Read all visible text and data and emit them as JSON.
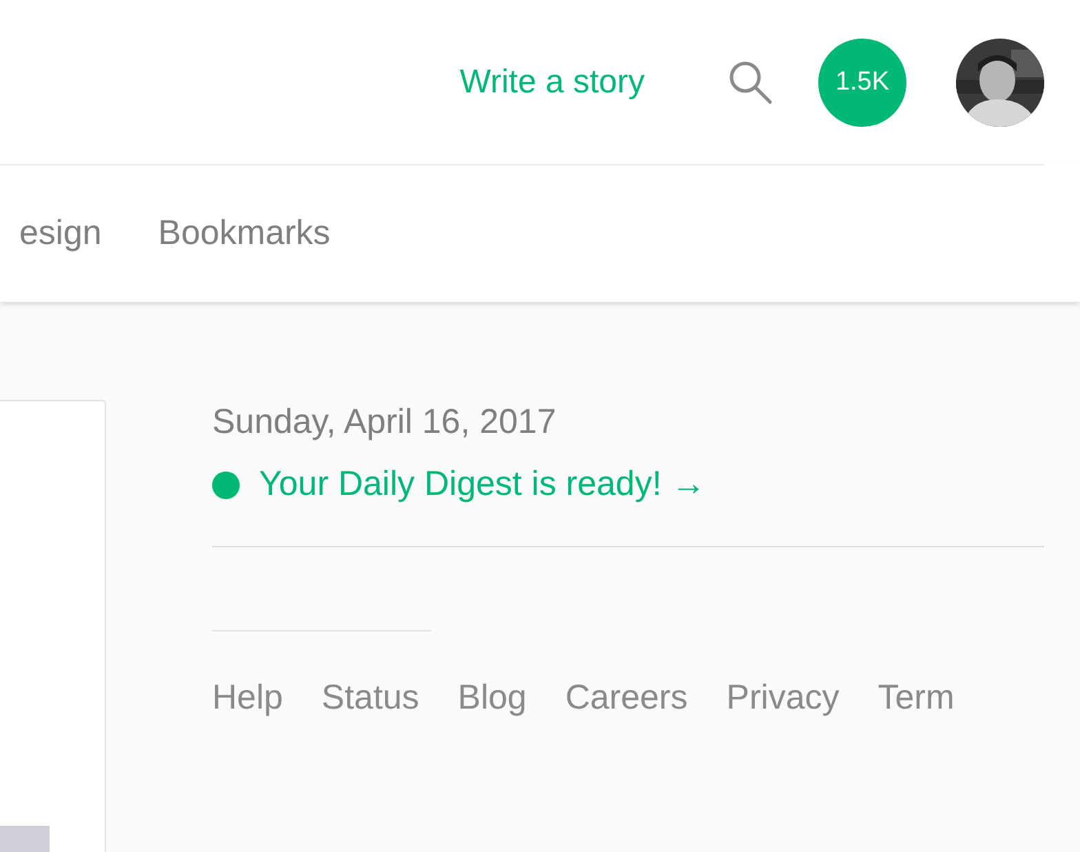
{
  "header": {
    "write_link": "Write a story",
    "notification_count": "1.5K"
  },
  "nav": {
    "tabs": [
      {
        "label": "esign",
        "selected": false
      },
      {
        "label": "Bookmarks",
        "selected": false
      }
    ]
  },
  "sidebar": {
    "date": "Sunday, April 16, 2017",
    "digest_link": "Your Daily Digest is ready! →",
    "footer_links": [
      "Help",
      "Status",
      "Blog",
      "Careers",
      "Privacy",
      "Term"
    ]
  }
}
